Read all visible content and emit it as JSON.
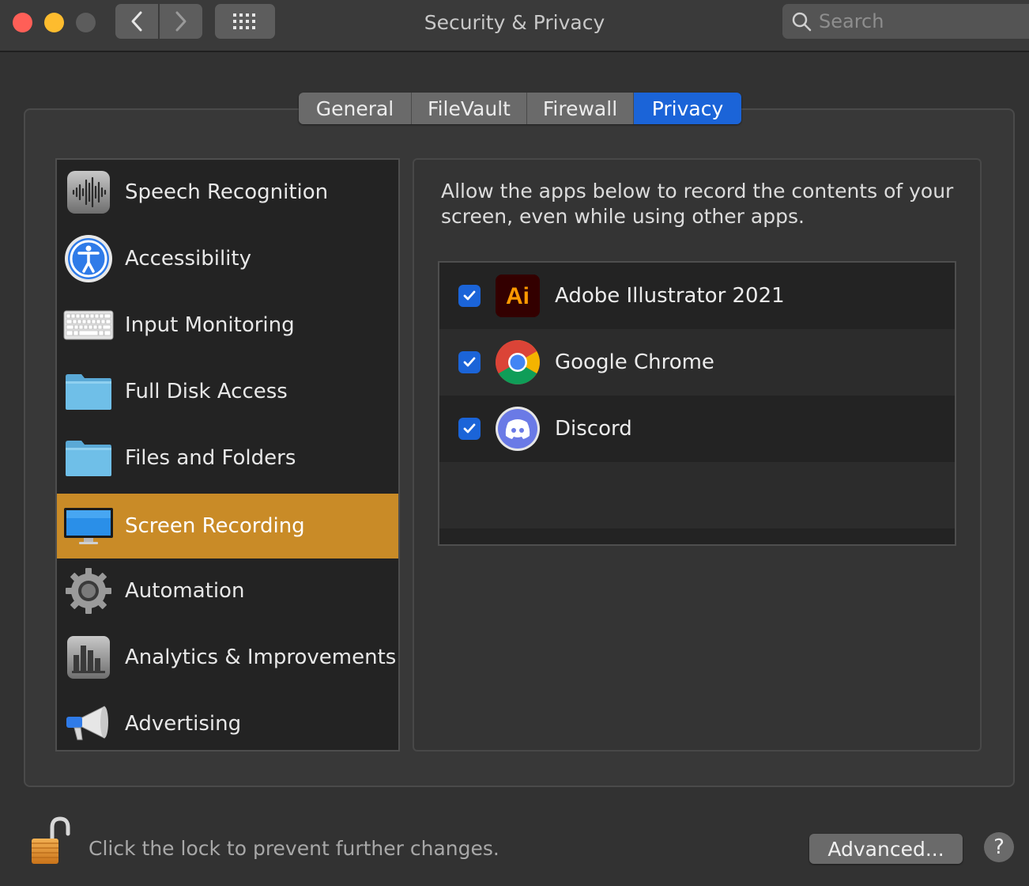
{
  "window": {
    "title": "Security & Privacy",
    "search_placeholder": "Search"
  },
  "tabs": [
    {
      "label": "General",
      "active": false
    },
    {
      "label": "FileVault",
      "active": false
    },
    {
      "label": "Firewall",
      "active": false
    },
    {
      "label": "Privacy",
      "active": true
    }
  ],
  "sidebar": {
    "items": [
      {
        "label": "Speech Recognition",
        "icon": "waveform-icon"
      },
      {
        "label": "Accessibility",
        "icon": "accessibility-icon"
      },
      {
        "label": "Input Monitoring",
        "icon": "keyboard-icon"
      },
      {
        "label": "Full Disk Access",
        "icon": "folder-icon"
      },
      {
        "label": "Files and Folders",
        "icon": "folder-icon"
      },
      {
        "label": "Screen Recording",
        "icon": "monitor-icon",
        "selected": true
      },
      {
        "label": "Automation",
        "icon": "gear-icon"
      },
      {
        "label": "Analytics & Improvements",
        "icon": "bar-chart-icon"
      },
      {
        "label": "Advertising",
        "icon": "megaphone-icon"
      }
    ]
  },
  "pane": {
    "description": "Allow the apps below to record the contents of your screen, even while using other apps.",
    "apps": [
      {
        "name": "Adobe Illustrator 2021",
        "checked": true,
        "icon": "illustrator-icon",
        "icon_text": "Ai"
      },
      {
        "name": "Google Chrome",
        "checked": true,
        "icon": "chrome-icon"
      },
      {
        "name": "Discord",
        "checked": true,
        "icon": "discord-icon"
      }
    ]
  },
  "footer": {
    "lock_text": "Click the lock to prevent further changes.",
    "advanced_label": "Advanced...",
    "help_label": "?"
  },
  "colors": {
    "accent": "#1b64d8",
    "selection": "#c98b27"
  }
}
